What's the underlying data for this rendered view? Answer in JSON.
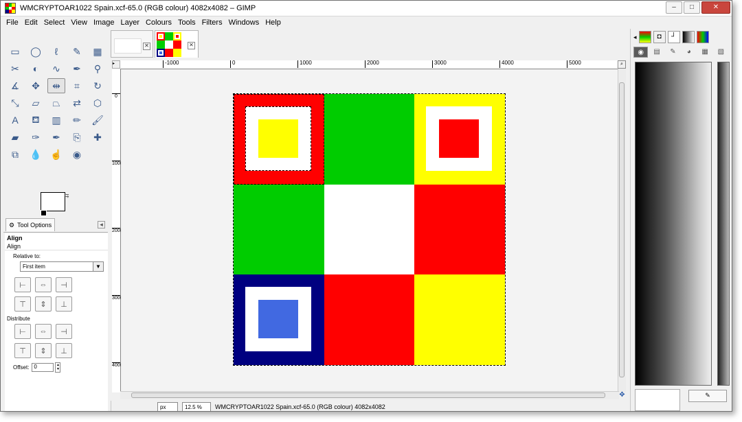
{
  "window": {
    "title": "WMCRYPTOAR1022 Spain.xcf-65.0 (RGB colour) 4082x4082 – GIMP",
    "minimize": "–",
    "maximize": "□",
    "close": "✕"
  },
  "menu": [
    {
      "label": "File"
    },
    {
      "label": "Edit"
    },
    {
      "label": "Select"
    },
    {
      "label": "View"
    },
    {
      "label": "Image"
    },
    {
      "label": "Layer"
    },
    {
      "label": "Colours"
    },
    {
      "label": "Tools"
    },
    {
      "label": "Filters"
    },
    {
      "label": "Windows"
    },
    {
      "label": "Help"
    }
  ],
  "tools": [
    {
      "name": "rect-select-icon",
      "glyph": "▭"
    },
    {
      "name": "ellipse-select-icon",
      "glyph": "◯"
    },
    {
      "name": "free-select-icon",
      "glyph": "ℓ"
    },
    {
      "name": "fuzzy-select-icon",
      "glyph": "✎"
    },
    {
      "name": "color-select-icon",
      "glyph": "▦"
    },
    {
      "name": "scissors-icon",
      "glyph": "✂"
    },
    {
      "name": "foreground-select-icon",
      "glyph": "◐"
    },
    {
      "name": "paths-icon",
      "glyph": "∿"
    },
    {
      "name": "color-picker-icon",
      "glyph": "✒"
    },
    {
      "name": "zoom-icon",
      "glyph": "⚲"
    },
    {
      "name": "measure-icon",
      "glyph": "∡"
    },
    {
      "name": "move-icon",
      "glyph": "✥"
    },
    {
      "name": "align-icon",
      "glyph": "⇹"
    },
    {
      "name": "crop-icon",
      "glyph": "⌗"
    },
    {
      "name": "rotate-icon",
      "glyph": "↻"
    },
    {
      "name": "scale-icon",
      "glyph": "⤡"
    },
    {
      "name": "shear-icon",
      "glyph": "▱"
    },
    {
      "name": "perspective-icon",
      "glyph": "⏢"
    },
    {
      "name": "flip-icon",
      "glyph": "⇄"
    },
    {
      "name": "cage-icon",
      "glyph": "⬡"
    },
    {
      "name": "text-icon",
      "glyph": "A"
    },
    {
      "name": "bucket-fill-icon",
      "glyph": "⛾"
    },
    {
      "name": "blend-icon",
      "glyph": "▥"
    },
    {
      "name": "pencil-icon",
      "glyph": "✏"
    },
    {
      "name": "paintbrush-icon",
      "glyph": "🖌"
    },
    {
      "name": "eraser-icon",
      "glyph": "▰"
    },
    {
      "name": "airbrush-icon",
      "glyph": "✑"
    },
    {
      "name": "ink-icon",
      "glyph": "✒"
    },
    {
      "name": "clone-icon",
      "glyph": "⎘"
    },
    {
      "name": "heal-icon",
      "glyph": "✚"
    },
    {
      "name": "perspective-clone-icon",
      "glyph": "⧉"
    },
    {
      "name": "blur-icon",
      "glyph": "💧"
    },
    {
      "name": "smudge-icon",
      "glyph": "☝"
    },
    {
      "name": "dodge-burn-icon",
      "glyph": "◉"
    }
  ],
  "colors": {
    "red": "#ff0000",
    "green": "#00cc00",
    "yellow": "#ffff00",
    "white": "#ffffff",
    "navy": "#000080",
    "blue": "#4169e1"
  },
  "tool_options": {
    "tab_label": "Tool Options",
    "title": "Align",
    "subtitle": "Align",
    "relative_to_label": "Relative to:",
    "relative_to_value": "First item",
    "distribute_label": "Distribute",
    "offset_label": "Offset:",
    "offset_value": "0"
  },
  "align_buttons": [
    {
      "name": "align-left-edge-button",
      "glyph": "⊢"
    },
    {
      "name": "align-center-horizontal-button",
      "glyph": "⇔"
    },
    {
      "name": "align-right-edge-button",
      "glyph": "⊣"
    },
    {
      "name": "align-top-edge-button",
      "glyph": "⊤"
    },
    {
      "name": "align-middle-vertical-button",
      "glyph": "⇕"
    },
    {
      "name": "align-bottom-edge-button",
      "glyph": "⊥"
    }
  ],
  "distribute_buttons": [
    {
      "name": "distribute-left-button",
      "glyph": "⊢"
    },
    {
      "name": "distribute-center-button",
      "glyph": "⇔"
    },
    {
      "name": "distribute-right-button",
      "glyph": "⊣"
    },
    {
      "name": "distribute-top-button",
      "glyph": "⊤"
    },
    {
      "name": "distribute-middle-button",
      "glyph": "⇕"
    },
    {
      "name": "distribute-bottom-button",
      "glyph": "⊥"
    }
  ],
  "ruler": {
    "h_labels": [
      "-1000",
      "0",
      "1000",
      "2000",
      "3000",
      "4000",
      "5000"
    ],
    "v_labels": [
      "0",
      "1000",
      "2000",
      "3000",
      "4000"
    ]
  },
  "image_grid": [
    {
      "bg": "red",
      "frame": "white",
      "inner": "yellow",
      "selection": true
    },
    {
      "bg": "green"
    },
    {
      "bg": "yellow",
      "frame": "white",
      "inner": "red"
    },
    {
      "bg": "green"
    },
    {
      "bg": "white"
    },
    {
      "bg": "red"
    },
    {
      "bg": "navy",
      "frame": "white",
      "inner": "blue"
    },
    {
      "bg": "red"
    },
    {
      "bg": "yellow"
    }
  ],
  "statusbar": {
    "unit": "px",
    "zoom": "12.5 %",
    "text": "WMCRYPTOAR1022 Spain.xcf-65.0 (RGB colour) 4082x4082"
  }
}
